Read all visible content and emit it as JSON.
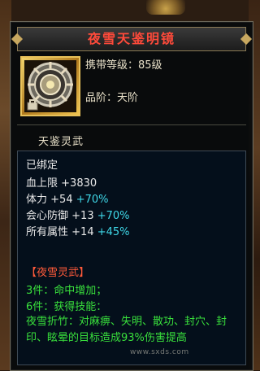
{
  "item": {
    "name": "夜雪天鉴明镜",
    "level_label": "携带等级：85级",
    "grade_label": "品阶：天阶",
    "set_name": "天鉴灵武"
  },
  "stats": {
    "bound": "已绑定",
    "hp": {
      "label": "血上限",
      "base": "+3830"
    },
    "con": {
      "label": "体力",
      "base": "+54",
      "bonus": "+70%"
    },
    "mdef": {
      "label": "会心防御",
      "base": "+13",
      "bonus": "+70%"
    },
    "all": {
      "label": "所有属性",
      "base": "+14",
      "bonus": "+45%"
    }
  },
  "set": {
    "title": "【夜雪灵武】",
    "piece3": "3件：命中增加；",
    "piece6": "6件：获得技能：",
    "skill_desc": "夜雪折竹：对麻痹、失明、散功、封穴、封印、眩晕的目标造成93%伤害提高"
  },
  "watermark": "www.sxds.com",
  "colors": {
    "title": "#ff4a3a",
    "set_title": "#ff5a3a",
    "bonus": "#3fd8e8",
    "green": "#39e03c"
  }
}
